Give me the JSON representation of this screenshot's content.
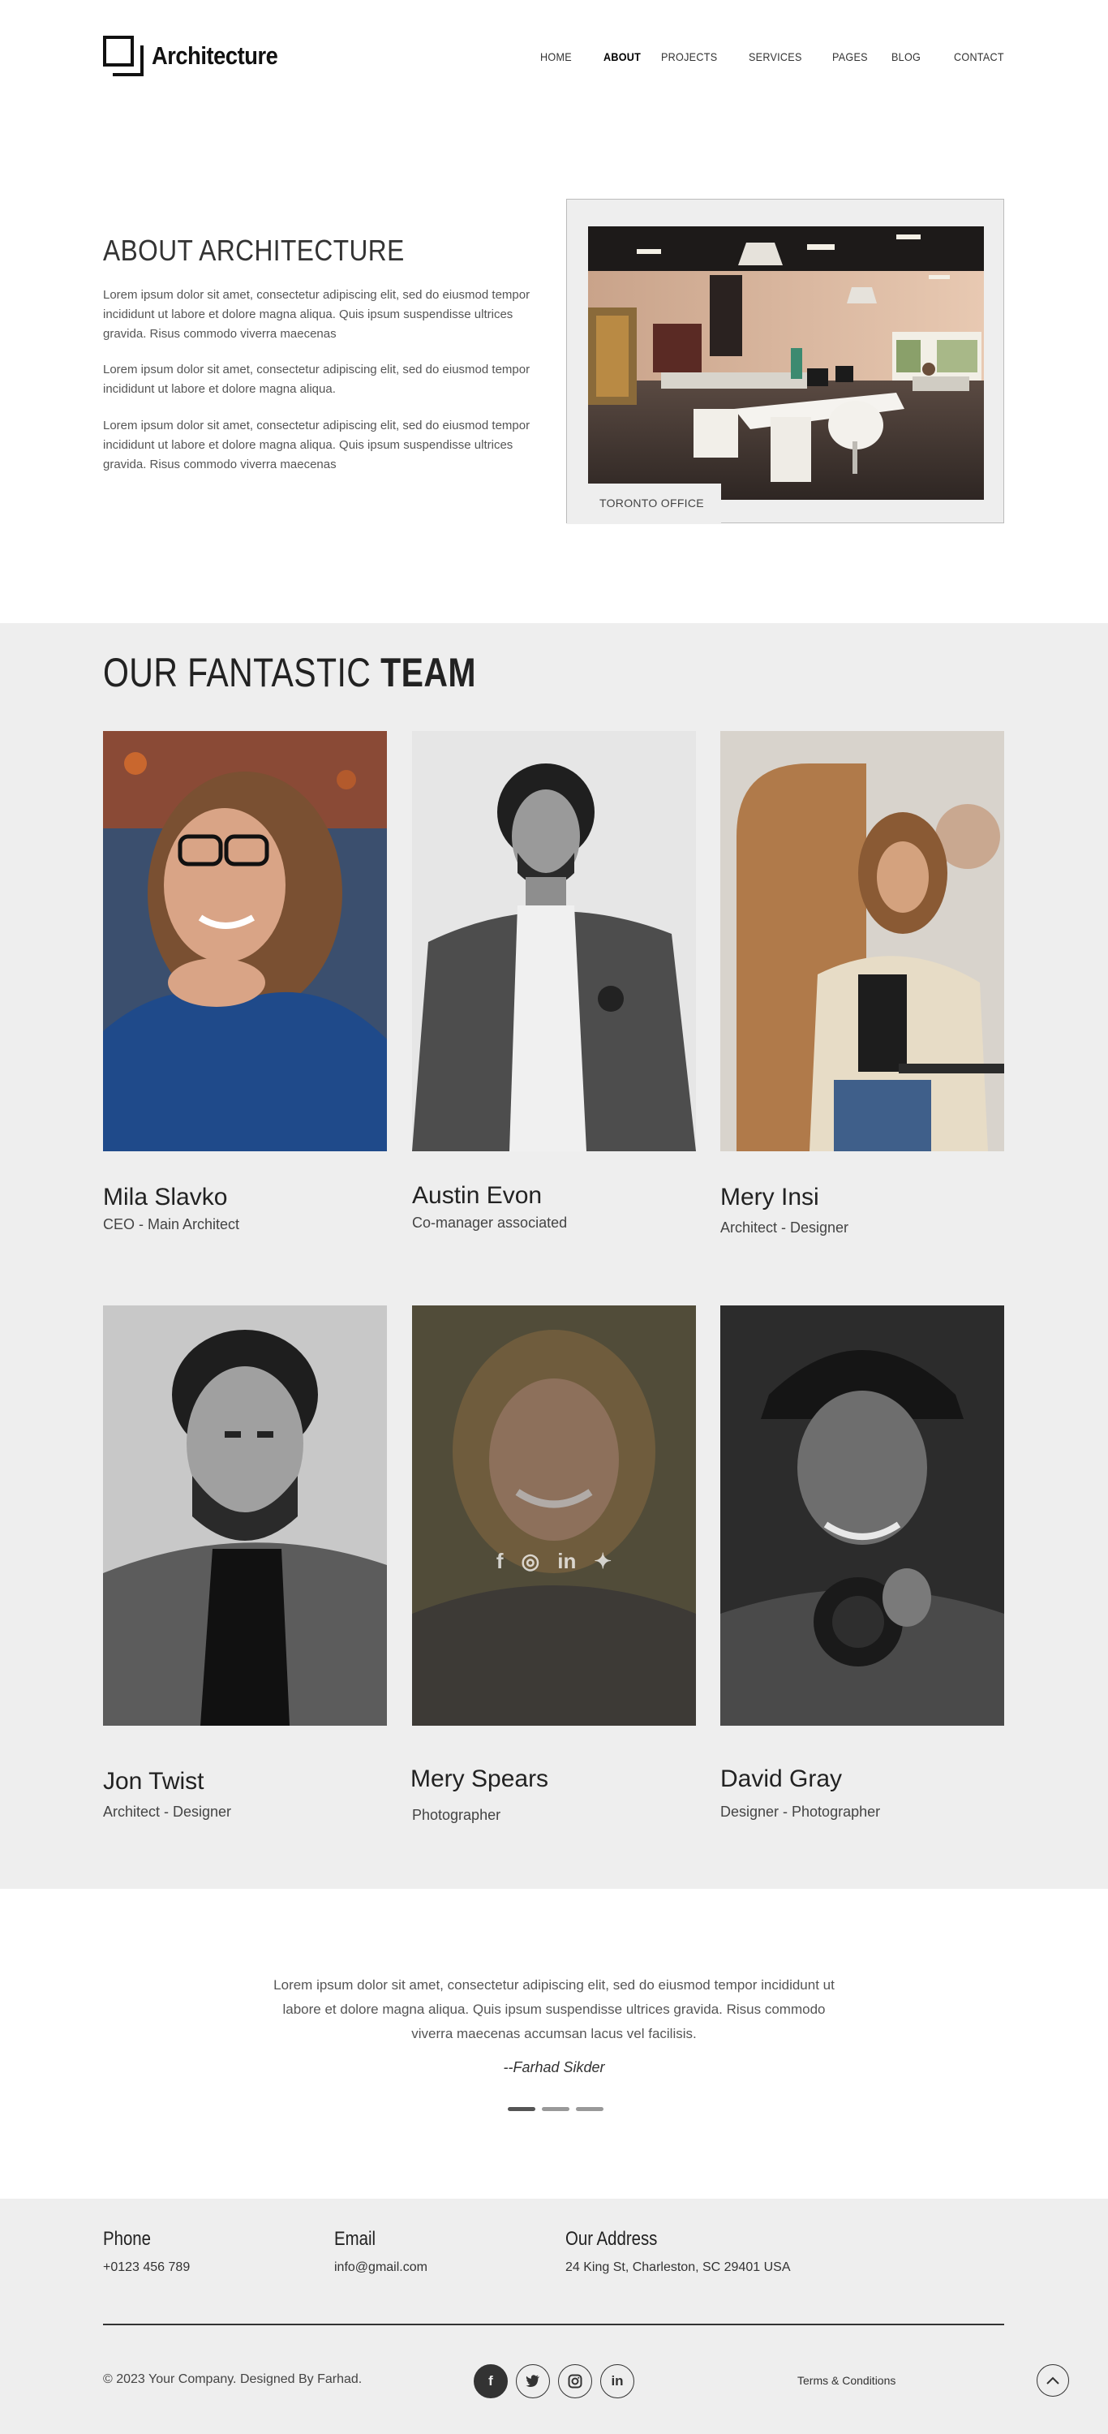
{
  "brand": {
    "name": "Architecture"
  },
  "nav": {
    "items": [
      "HOME",
      "ABOUT",
      "PROJECTS",
      "SERVICES",
      "PAGES",
      "BLOG",
      "CONTACT"
    ],
    "active": "ABOUT"
  },
  "about": {
    "title": "ABOUT ARCHITECTURE",
    "paragraphs": [
      "Lorem ipsum dolor sit amet, consectetur adipiscing elit, sed do eiusmod tempor incididunt ut labore et dolore magna aliqua. Quis ipsum suspendisse ultrices gravida.  Risus commodo viverra maecenas",
      "Lorem ipsum dolor sit amet, consectetur adipiscing elit, sed do eiusmod tempor incididunt ut labore et dolore magna aliqua.",
      "Lorem ipsum dolor sit amet, consectetur adipiscing elit, sed do eiusmod tempor incididunt ut labore et dolore magna aliqua. Quis ipsum suspendisse ultrices gravida.  Risus commodo viverra maecenas"
    ],
    "image_caption": "TORONTO OFFICE"
  },
  "team": {
    "heading_light": "OUR FANTASTIC ",
    "heading_bold": "TEAM",
    "members": [
      {
        "name": "Mila Slavko",
        "role": "CEO - Main Architect"
      },
      {
        "name": "Austin Evon",
        "role": "Co-manager associated"
      },
      {
        "name": "Mery Insi",
        "role": "Architect - Designer"
      },
      {
        "name": "Jon Twist",
        "role": "Architect - Designer"
      },
      {
        "name": "Mery Spears",
        "role": "Photographer"
      },
      {
        "name": "David Gray",
        "role": "Designer - Photographer"
      }
    ],
    "social_overlay": [
      "f",
      "instagram",
      "in",
      "twitter"
    ]
  },
  "testimonial": {
    "text": "Lorem ipsum dolor sit amet, consectetur adipiscing elit, sed do eiusmod tempor incididunt ut labore et dolore magna aliqua. Quis ipsum suspendisse ultrices gravida.  Risus commodo viverra maecenas accumsan lacus vel facilisis.",
    "author": "--Farhad Sikder",
    "slides": 3,
    "active_slide": 1
  },
  "footer": {
    "phone_label": "Phone",
    "phone": "+0123 456 789",
    "email_label": "Email",
    "email": "info@gmail.com",
    "address_label": "Our Address",
    "address": "24  King St, Charleston, SC 29401 USA",
    "copyright": "© 2023 Your Company. Designed By Farhad.",
    "social": [
      "facebook-icon",
      "twitter-icon",
      "instagram-icon",
      "linkedin-icon"
    ],
    "terms": "Terms & Conditions"
  }
}
